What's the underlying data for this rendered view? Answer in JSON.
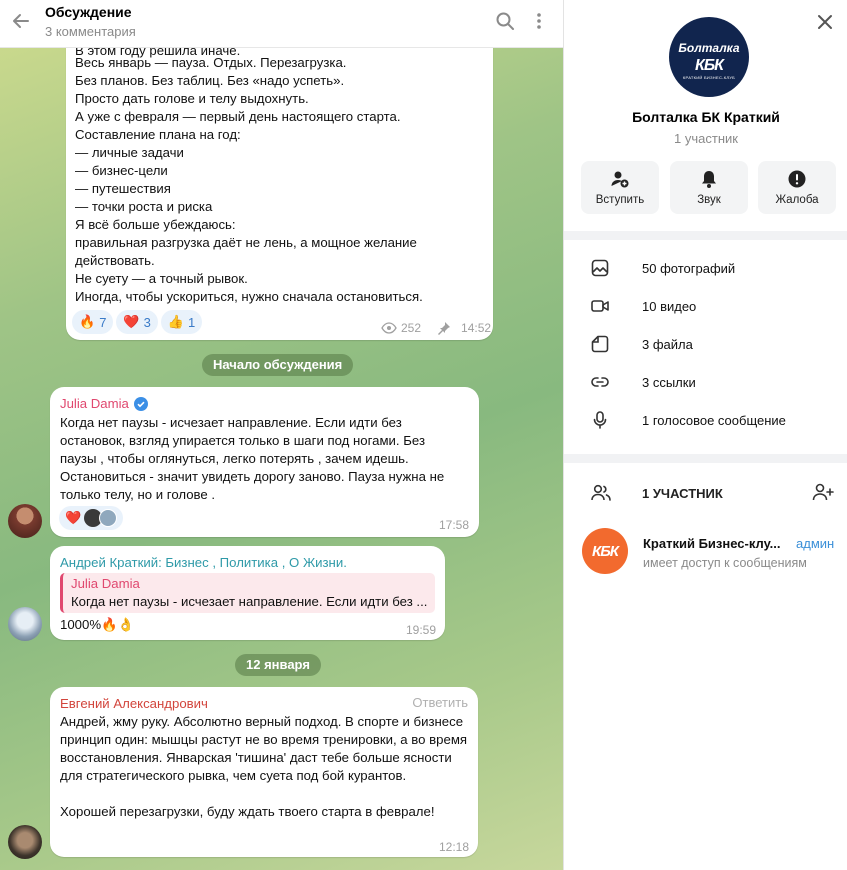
{
  "header": {
    "title": "Обсуждение",
    "subtitle": "3 комментария"
  },
  "post": {
    "lines_partial": "В этом году решила иначе.",
    "text": "Весь январь — пауза. Отдых. Перезагрузка.\nБез планов. Без таблиц. Без «надо успеть».\nПросто дать голове и телу выдохнуть.\nА уже с февраля — первый день настоящего старта.\nСоставление плана на год:\n— личные задачи\n— бизнес-цели\n— путешествия\n— точки роста и риска\nЯ всё больше убеждаюсь:\nправильная разгрузка даёт не лень, а мощное желание действовать.\nНе суету — а точный рывок.\nИногда, чтобы ускориться, нужно сначала остановиться.",
    "reactions": [
      {
        "emoji": "🔥",
        "count": "7"
      },
      {
        "emoji": "❤️",
        "count": "3"
      },
      {
        "emoji": "👍",
        "count": "1"
      }
    ],
    "views": "252",
    "time": "14:52"
  },
  "discussion_start_label": "Начало обсуждения",
  "comment1": {
    "author": "Julia Damia",
    "author_color": "#e0486f",
    "text": "Когда нет паузы - исчезает направление. Если идти без остановок, взгляд упирается только в шаги под ногами. Без паузы , чтобы оглянуться, легко потерять , зачем идешь. Остановиться - значит увидеть дорогу заново. Пауза нужна не только телу, но и голове .",
    "reaction_emoji": "❤️",
    "time": "17:58"
  },
  "comment2": {
    "author": "Андрей Краткий: Бизнес , Политика , О Жизни.",
    "author_color": "#2f9aa8",
    "reply_author": "Julia Damia",
    "reply_text": "Когда нет паузы - исчезает направление. Если идти без ...",
    "text": "1000%🔥👌",
    "time": "19:59"
  },
  "date_divider": "12 января",
  "comment3": {
    "author": "Евгений Александрович",
    "author_color": "#d2453c",
    "reply_label": "Ответить",
    "text": "Андрей, жму руку. Абсолютно верный подход. В спорте и бизнесе принцип один: мышцы растут не во время тренировки, а во время восстановления. Январская 'тишина' даст тебе больше ясности для стратегического рывка, чем суета под бой курантов.\n\nХорошей перезагрузки, буду ждать твоего старта в феврале!",
    "time": "12:18"
  },
  "info": {
    "avatar_text": "Болталка",
    "avatar_logo": "КБК",
    "avatar_logo_sub": "КРАТКИЙ БИЗНЕС-КЛУБ",
    "name": "Болталка БК Краткий",
    "members": "1 участник",
    "actions": [
      {
        "label": "Вступить",
        "icon": "add-user-icon"
      },
      {
        "label": "Звук",
        "icon": "bell-icon"
      },
      {
        "label": "Жалоба",
        "icon": "warning-icon"
      }
    ],
    "media": [
      {
        "label": "50 фотографий",
        "icon": "photo-icon"
      },
      {
        "label": "10 видео",
        "icon": "video-icon"
      },
      {
        "label": "3 файла",
        "icon": "file-icon"
      },
      {
        "label": "3 ссылки",
        "icon": "link-icon"
      },
      {
        "label": "1 голосовое сообщение",
        "icon": "mic-icon"
      }
    ],
    "members_header": "1 УЧАСТНИК",
    "member": {
      "avatar_text": "КБК",
      "name": "Краткий Бизнес-клу...",
      "role": "админ",
      "status": "имеет доступ к сообщениям"
    }
  }
}
